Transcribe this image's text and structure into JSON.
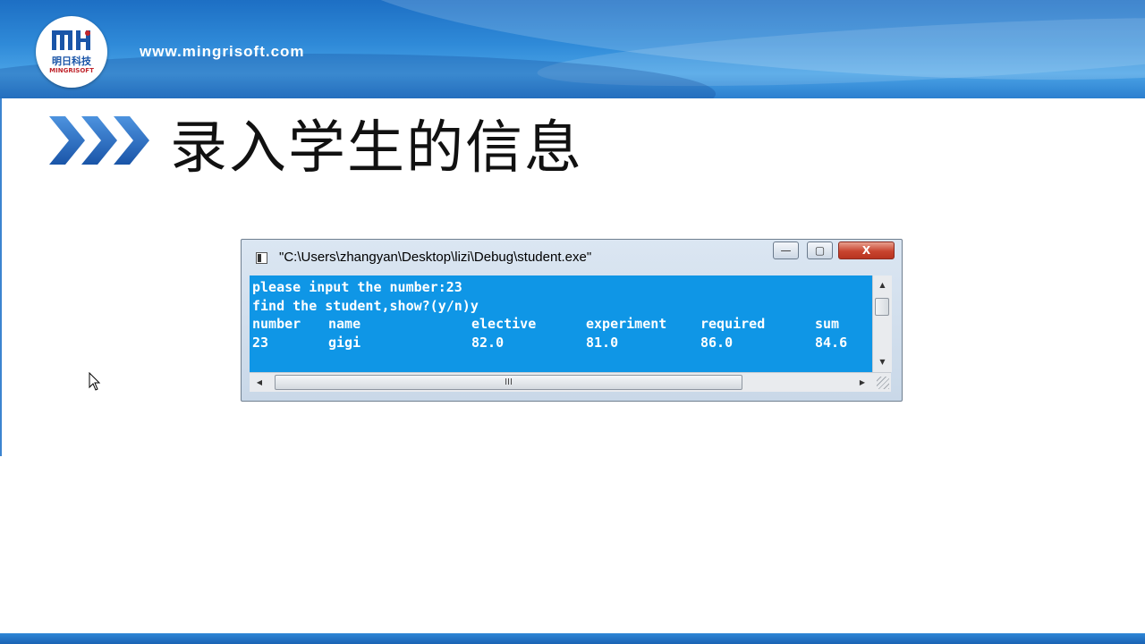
{
  "header": {
    "logo_text_cn": "明日科技",
    "logo_text_en": "MINGRISOFT",
    "url": "www.mingrisoft.com"
  },
  "slide": {
    "title": "录入学生的信息"
  },
  "console_window": {
    "title": "\"C:\\Users\\zhangyan\\Desktop\\lizi\\Debug\\student.exe\"",
    "controls": {
      "minimize": "—",
      "maximize": "▢",
      "close": "X"
    },
    "lines": [
      "please input the number:23",
      "find the student,show?(y/n)y"
    ],
    "table": {
      "headers": [
        "number",
        "name",
        "elective",
        "experiment",
        "required",
        "sum"
      ],
      "rows": [
        [
          "23",
          "gigi",
          "82.0",
          "81.0",
          "86.0",
          "84.6"
        ]
      ]
    },
    "hscroll_grip": "III",
    "background_color": "#0f96e6"
  },
  "colors": {
    "banner": "#2f8ad8",
    "footer": "#1a63b4",
    "chevron": "#1e5fb8"
  }
}
